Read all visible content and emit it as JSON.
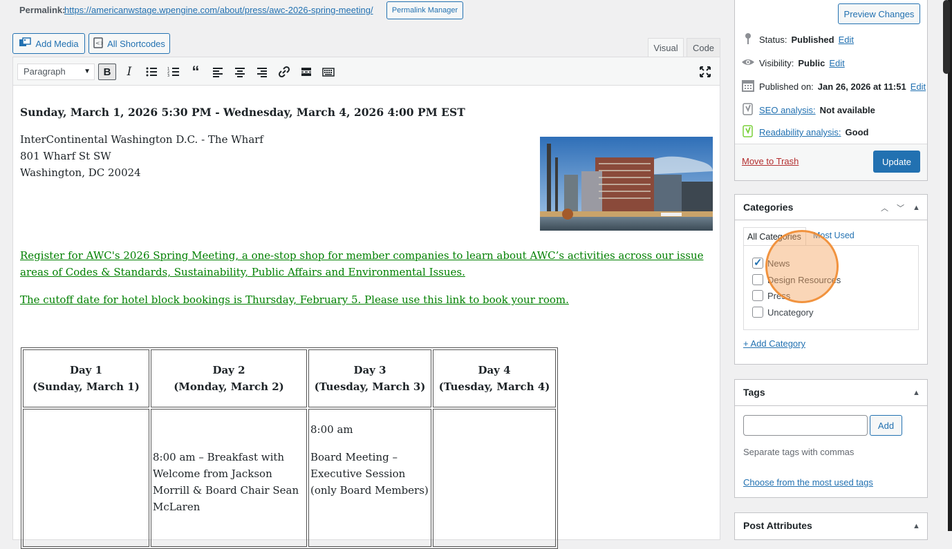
{
  "permalink": {
    "label": "Permalink:",
    "url": "https://americanwstage.wpengine.com/about/press/awc-2026-spring-meeting/",
    "manager_button": "Permalink Manager"
  },
  "media_buttons": {
    "add_media": "Add Media",
    "all_shortcodes": "All Shortcodes"
  },
  "editor_tabs": {
    "visual": "Visual",
    "code": "Code"
  },
  "toolbar": {
    "format": "Paragraph",
    "bold": "B"
  },
  "content": {
    "event_dates": "Sunday, March 1, 2026 5:30 PM - Wednesday, March 4, 2026 4:00 PM EST",
    "address": [
      "InterContinental Washington D.C. - The Wharf",
      "801 Wharf St SW",
      "Washington, DC 20024"
    ],
    "register_link": "Register for AWC's 2026 Spring Meeting, a one-stop shop for member companies to learn about AWC’s activities across our issue areas of Codes & Standards, Sustainability, Public Affairs and Environmental Issues.",
    "cutoff_link": "The cutoff date for hotel block bookings is Thursday, February 5. Please use this link to book your room.",
    "schedule": {
      "headers": [
        {
          "day": "Day 1",
          "date": "(Sunday, March 1)"
        },
        {
          "day": "Day 2",
          "date": "(Monday, March 2)"
        },
        {
          "day": "Day 3",
          "date": "(Tuesday, March 3)"
        },
        {
          "day": "Day 4",
          "date": "(Tuesday, March 4)"
        }
      ],
      "day2_line": "8:00 am – Breakfast with Welcome from Jackson Morrill & Board Chair Sean McLaren",
      "day3_time": "8:00 am",
      "day3_line": "Board Meeting – Executive Session (only Board Members)"
    }
  },
  "publish": {
    "preview_button": "Preview Changes",
    "status_label": "Status:",
    "status_value": "Published",
    "visibility_label": "Visibility:",
    "visibility_value": "Public",
    "published_label": "Published on:",
    "published_value": "Jan 26, 2026 at 11:51",
    "edit": "Edit",
    "seo_link": "SEO analysis:",
    "seo_value": "Not available",
    "readability_link": "Readability analysis:",
    "readability_value": "Good",
    "trash": "Move to Trash",
    "update": "Update"
  },
  "categories": {
    "title": "Categories",
    "tab_all": "All Categories",
    "tab_most_used": "Most Used",
    "items": [
      {
        "label": "News",
        "checked": true
      },
      {
        "label": "Design Resources",
        "checked": false
      },
      {
        "label": "Press",
        "checked": false
      },
      {
        "label": "Uncategory",
        "checked": false
      }
    ],
    "add_link": "+ Add Category"
  },
  "tags": {
    "title": "Tags",
    "add_button": "Add",
    "help": "Separate tags with commas",
    "choose_link": "Choose from the most used tags"
  },
  "post_attributes": {
    "title": "Post Attributes"
  },
  "colors": {
    "link": "#2271b1",
    "green_link": "#008000",
    "trash": "#b32d2e",
    "update_bg": "#2271b1",
    "highlight": "#f4a460"
  }
}
